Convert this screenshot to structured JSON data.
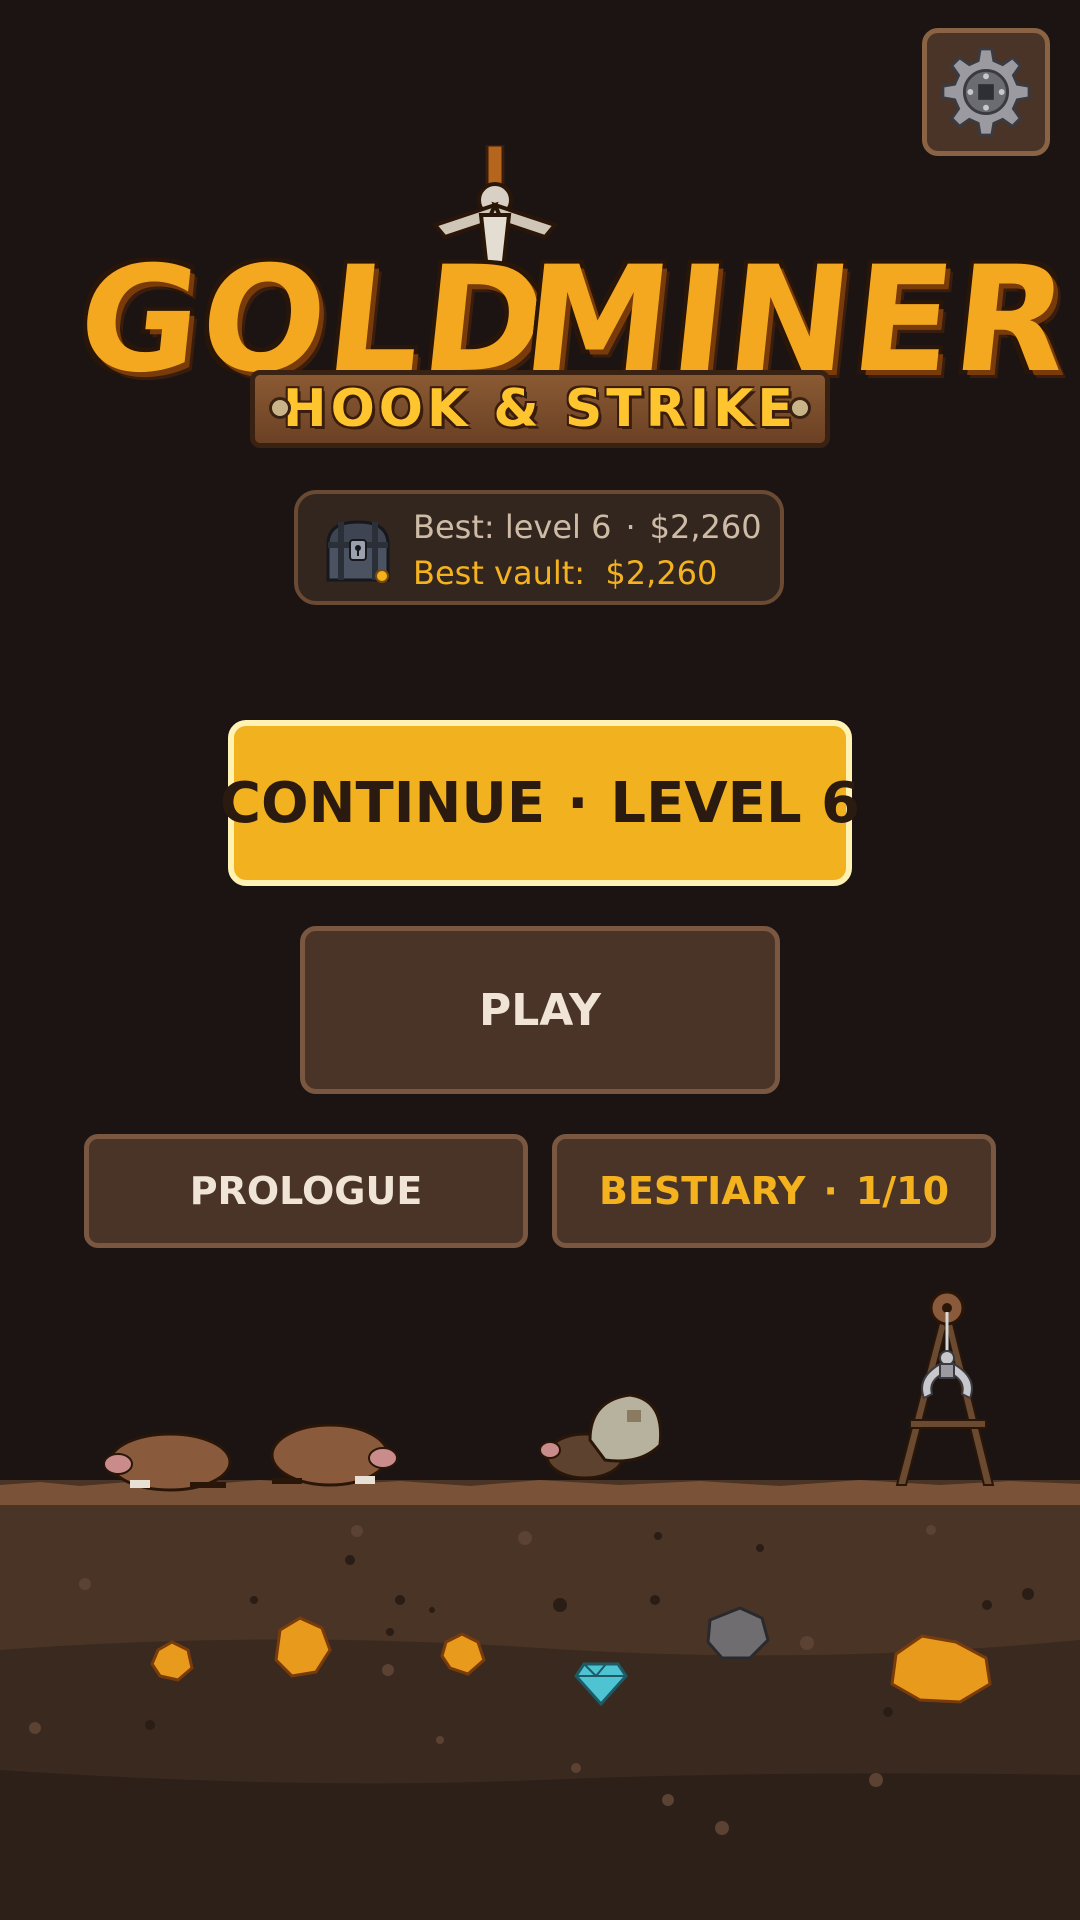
{
  "logo": {
    "title_word1": "GOLD",
    "title_word2": "MINER",
    "subtitle": "HOOK & STRIKE"
  },
  "stats": {
    "best_level": "Best: level 6",
    "best_money": "$2,260",
    "best_vault_label": "Best vault:",
    "best_vault_value": "$2,260",
    "dot": "·"
  },
  "menu": {
    "continue_label": "CONTINUE",
    "continue_level": "LEVEL 6",
    "play_label": "PLAY",
    "prologue_label": "PROLOGUE",
    "bestiary_label": "BESTIARY",
    "bestiary_count": "1/10",
    "dot": "·"
  },
  "icons": {
    "settings": "gear-icon",
    "chest": "treasure-chest-icon"
  },
  "colors": {
    "background": "#1b1412",
    "accent": "#f2b21f",
    "button_bg": "#4a3427",
    "gold_text": "#f3b21e"
  }
}
